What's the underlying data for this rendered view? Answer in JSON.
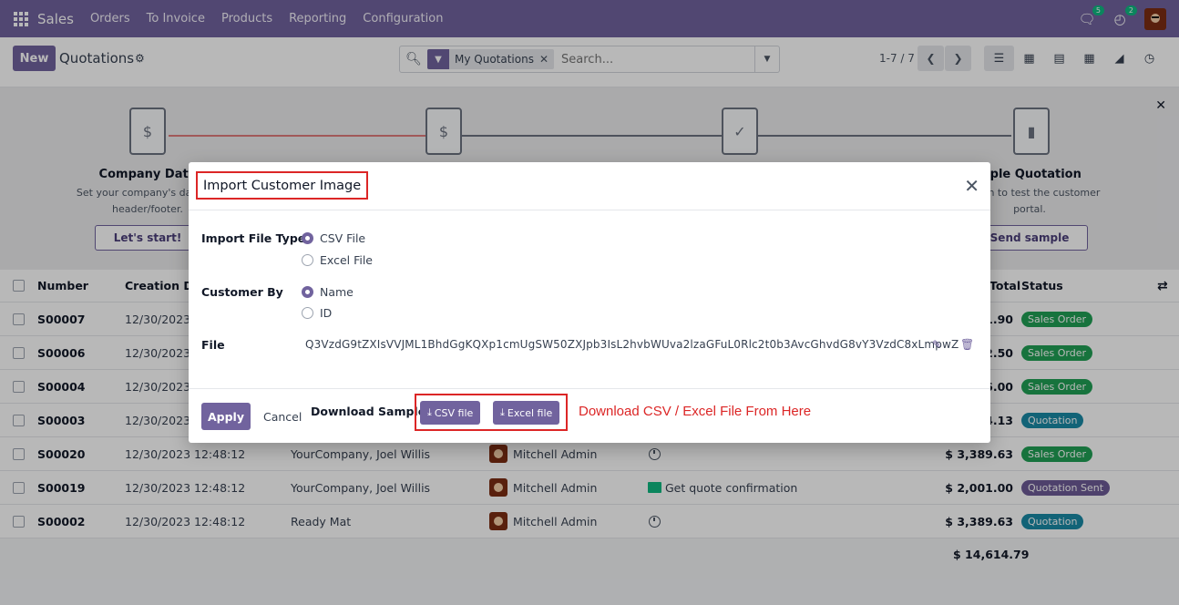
{
  "navbar": {
    "brand": "Sales",
    "menu": [
      "Orders",
      "To Invoice",
      "Products",
      "Reporting",
      "Configuration"
    ],
    "messages_count": "5",
    "activities_count": "2"
  },
  "control": {
    "new_label": "New",
    "title": "Quotations",
    "facet_label": "My Quotations",
    "search_placeholder": "Search...",
    "pager": "1-7 / 7"
  },
  "onboarding": {
    "step1_title": "Company Data",
    "step1_desc1": "Set your company's data for",
    "step1_desc2": "header/footer.",
    "step1_button": "Let's start!",
    "step4_title": "mple Quotation",
    "step4_desc1": "otation to test the customer",
    "step4_desc2": "portal.",
    "step4_button": "Send sample"
  },
  "list": {
    "columns": {
      "number": "Number",
      "creation_date": "Creation Da",
      "total": "Total",
      "status": "Status"
    },
    "rows": [
      {
        "number": "S00007",
        "date": "12/30/2023",
        "customer": "",
        "salesperson": "",
        "activity": "",
        "total": "1.90",
        "status": "Sales Order",
        "status_color": "#21a055"
      },
      {
        "number": "S00006",
        "date": "12/30/2023",
        "customer": "",
        "salesperson": "",
        "activity": "",
        "total": "2.50",
        "status": "Sales Order",
        "status_color": "#21a055"
      },
      {
        "number": "S00004",
        "date": "12/30/2023",
        "customer": "",
        "salesperson": "",
        "activity": "",
        "total": "6.00",
        "status": "Sales Order",
        "status_color": "#21a055"
      },
      {
        "number": "S00003",
        "date": "12/30/2023",
        "customer": "",
        "salesperson": "",
        "activity": "",
        "total": "4.13",
        "status": "Quotation",
        "status_color": "#1a8aa6"
      },
      {
        "number": "S00020",
        "date": "12/30/2023 12:48:12",
        "customer": "YourCompany, Joel Willis",
        "salesperson": "Mitchell Admin",
        "activity": "",
        "total": "$ 3,389.63",
        "status": "Sales Order",
        "status_color": "#21a055"
      },
      {
        "number": "S00019",
        "date": "12/30/2023 12:48:12",
        "customer": "YourCompany, Joel Willis",
        "salesperson": "Mitchell Admin",
        "activity": "Get quote confirmation",
        "total": "$ 2,001.00",
        "status": "Quotation Sent",
        "status_color": "#6d5b96"
      },
      {
        "number": "S00002",
        "date": "12/30/2023 12:48:12",
        "customer": "Ready Mat",
        "salesperson": "Mitchell Admin",
        "activity": "",
        "total": "$ 3,389.63",
        "status": "Quotation",
        "status_color": "#1a8aa6"
      }
    ],
    "grand_total": "$ 14,614.79"
  },
  "dialog": {
    "title": "Import Customer Image",
    "file_type_label": "Import File Type",
    "file_type_options": [
      "CSV File",
      "Excel File"
    ],
    "customer_by_label": "Customer By",
    "customer_by_options": [
      "Name",
      "ID"
    ],
    "file_label": "File",
    "file_value": "Q3VzdG9tZXIsVVJML1BhdGgKQXp1cmUgSW50ZXJpb3IsL2hvbWUva2lzaGFuL0Rlc2t0b3AvcGhvdG8vY3VzdC8xLmpwZ",
    "apply_label": "Apply",
    "cancel_label": "Cancel",
    "download_label": "Download Sample:",
    "csv_button": "CSV file",
    "excel_button": "Excel file",
    "download_note": "Download CSV / Excel File From Here"
  },
  "colors": {
    "brand": "#71639e",
    "highlight": "#dc2626"
  }
}
